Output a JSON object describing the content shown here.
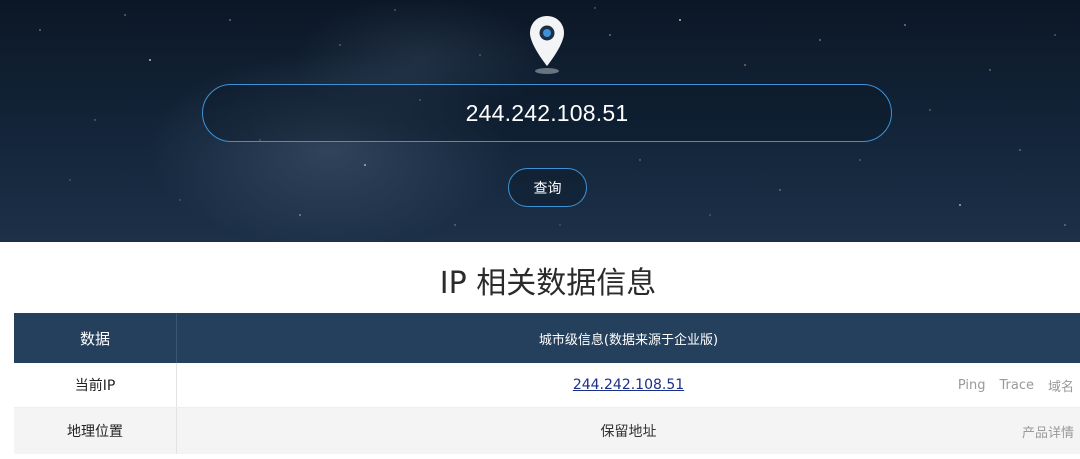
{
  "search": {
    "value": "244.242.108.51",
    "button_label": "查询"
  },
  "section": {
    "title": "IP 相关数据信息"
  },
  "table": {
    "header": {
      "key": "数据",
      "value": "城市级信息(数据来源于企业版)"
    },
    "rows": [
      {
        "key": "当前IP",
        "value": "244.242.108.51",
        "actions": [
          "Ping",
          "Trace",
          "域名"
        ]
      },
      {
        "key": "地理位置",
        "value": "保留地址",
        "actions": [
          "产品详情"
        ]
      }
    ]
  },
  "colors": {
    "accent": "#3d92d6",
    "header_bg": "#25405d",
    "link": "#1a2f8a"
  },
  "icons": [
    "location-pin-icon"
  ]
}
